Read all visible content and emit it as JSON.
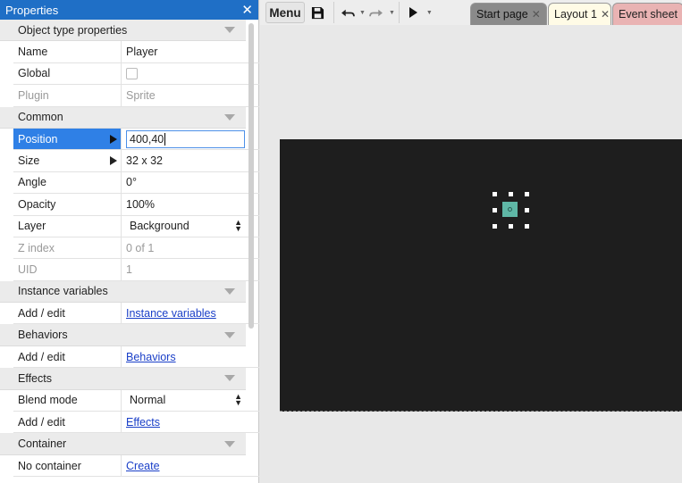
{
  "properties_panel": {
    "title": "Properties",
    "close_glyph": "✕",
    "sections": {
      "object_type": {
        "label": "Object type properties",
        "name": {
          "label": "Name",
          "value": "Player"
        },
        "global": {
          "label": "Global",
          "checked": false
        },
        "plugin": {
          "label": "Plugin",
          "value": "Sprite"
        }
      },
      "common": {
        "label": "Common",
        "position": {
          "label": "Position",
          "value": "400,40"
        },
        "size": {
          "label": "Size",
          "value": "32 x 32"
        },
        "angle": {
          "label": "Angle",
          "value": "0°"
        },
        "opacity": {
          "label": "Opacity",
          "value": "100%"
        },
        "layer": {
          "label": "Layer",
          "value": "Background"
        },
        "z_index": {
          "label": "Z index",
          "value": "0 of 1"
        },
        "uid": {
          "label": "UID",
          "value": "1"
        }
      },
      "instance_variables": {
        "label": "Instance variables",
        "add_edit": {
          "label": "Add / edit",
          "link": "Instance variables"
        }
      },
      "behaviors": {
        "label": "Behaviors",
        "add_edit": {
          "label": "Add / edit",
          "link": "Behaviors"
        }
      },
      "effects": {
        "label": "Effects",
        "blend_mode": {
          "label": "Blend mode",
          "value": "Normal"
        },
        "add_edit": {
          "label": "Add / edit",
          "link": "Effects"
        }
      },
      "container": {
        "label": "Container",
        "none": {
          "label": "No container",
          "link": "Create"
        }
      }
    }
  },
  "toolbar": {
    "menu_label": "Menu",
    "icons": [
      "save-icon",
      "undo-icon",
      "redo-icon",
      "play-icon"
    ]
  },
  "tabs": [
    {
      "label": "Start page",
      "active": false,
      "color": "#8a8a8a"
    },
    {
      "label": "Layout 1",
      "active": true,
      "color": "#fffbe6"
    },
    {
      "label": "Event sheet",
      "active": false,
      "color": "#e9b3b3"
    }
  ],
  "colors": {
    "accent": "#1f6fc6",
    "selected_row": "#2f80e6",
    "canvas": "#1e1e1e",
    "sprite": "#5fb7a6"
  }
}
